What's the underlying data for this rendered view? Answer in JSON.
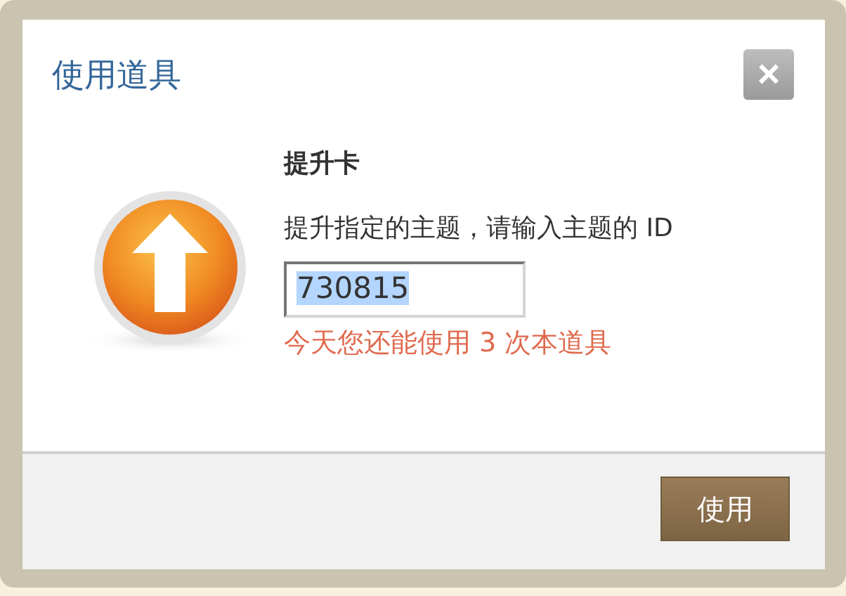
{
  "dialog": {
    "title": "使用道具",
    "close": "×"
  },
  "item": {
    "name": "提升卡",
    "description": "提升指定的主题，请输入主题的 ID",
    "input_value": "730815",
    "remaining": "今天您还能使用 3 次本道具"
  },
  "buttons": [
    "使用"
  ]
}
